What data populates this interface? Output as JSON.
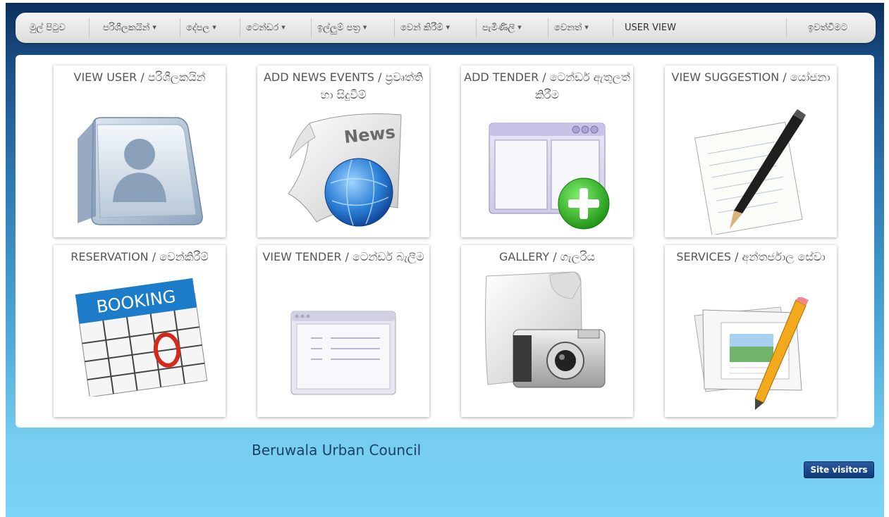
{
  "nav": {
    "items": [
      {
        "label": "මුල් පිටුව",
        "dropdown": false
      },
      {
        "label": "පරිශීලකයින්",
        "dropdown": true
      },
      {
        "label": "දේපල",
        "dropdown": true
      },
      {
        "label": "ටෙන්ඩර",
        "dropdown": true
      },
      {
        "label": "ඉල්ලුම් පත්‍ර",
        "dropdown": true
      },
      {
        "label": "වෙන් කිරීම්",
        "dropdown": true
      },
      {
        "label": "පැමිණිලි",
        "dropdown": true
      },
      {
        "label": "වෙනත්",
        "dropdown": true
      },
      {
        "label": "USER VIEW",
        "dropdown": false
      }
    ],
    "logout": "ඉවත්වීමට"
  },
  "tiles": [
    {
      "title": "VIEW USER / පරිශීලකයින්",
      "icon": "user-book-icon"
    },
    {
      "title": "ADD NEWS EVENTS / ප්‍රවෘත්ති හා සිදුවීම්",
      "icon": "news-globe-icon"
    },
    {
      "title": "ADD TENDER / ටෙන්ඩර් ඇතුලත් කිරීම",
      "icon": "window-add-icon"
    },
    {
      "title": "VIEW SUGGESTION / යෝජනා",
      "icon": "document-pen-icon"
    },
    {
      "title": "RESERVATION / වෙන්කිරීම්",
      "icon": "booking-calendar-icon"
    },
    {
      "title": "VIEW TENDER / ටෙන්ඩර් බැලීම",
      "icon": "window-list-icon"
    },
    {
      "title": "GALLERY / ගැලරිය",
      "icon": "camera-icon"
    },
    {
      "title": "SERVICES / අන්තර්ජාල සේවා",
      "icon": "papers-pencil-icon"
    }
  ],
  "icon_text": {
    "news": "News",
    "booking": "BOOKING"
  },
  "footer": {
    "council": "Beruwala Urban Council",
    "visitors": "Site visitors"
  },
  "colors": {
    "nav_bg": "#e6e6e6",
    "footer_text": "#1c3f66",
    "button": "#1a4a8c"
  }
}
